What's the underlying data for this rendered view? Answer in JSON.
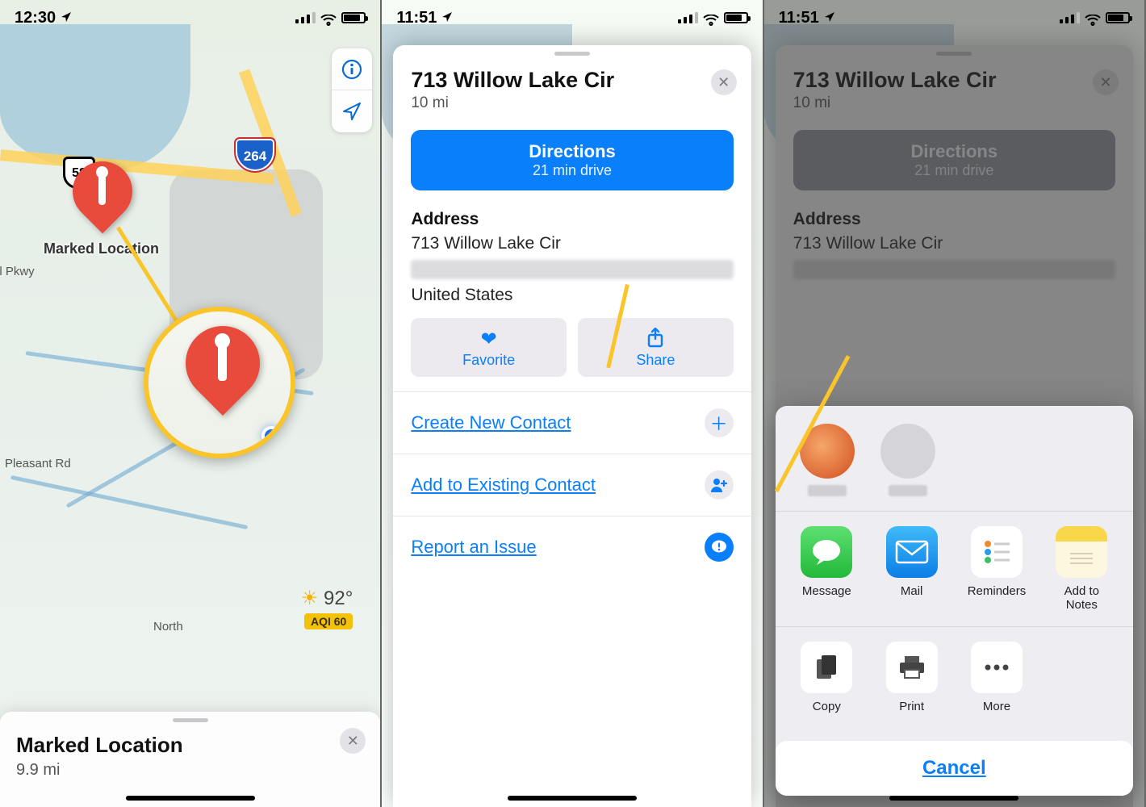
{
  "statusbar": {
    "time_p1": "12:30",
    "time_p23": "11:51"
  },
  "panel1": {
    "marked_location_label": "Marked Location",
    "highway_264": "264",
    "highway_58": "58",
    "road_llpkwy": "ll Pkwy",
    "road_pleasant": "Pleasant Rd",
    "road_north": "North",
    "weather_temp": "92°",
    "weather_aqi": "AQI 60",
    "card_title": "Marked Location",
    "card_distance": "9.9 mi"
  },
  "panel2": {
    "title": "713 Willow Lake Cir",
    "distance": "10 mi",
    "directions_label": "Directions",
    "directions_time": "21 min drive",
    "address_heading": "Address",
    "address_line1": "713 Willow Lake Cir",
    "address_country": "United States",
    "favorite_label": "Favorite",
    "share_label": "Share",
    "create_contact": "Create New Contact",
    "add_existing": "Add to Existing Contact",
    "report_issue": "Report an Issue"
  },
  "panel3": {
    "apps": {
      "message": "Message",
      "mail": "Mail",
      "reminders": "Reminders",
      "notes": "Add to Notes"
    },
    "actions": {
      "copy": "Copy",
      "print": "Print",
      "more": "More"
    },
    "cancel": "Cancel",
    "highlight_label": "Message"
  },
  "mag2": {
    "share": "Share"
  }
}
